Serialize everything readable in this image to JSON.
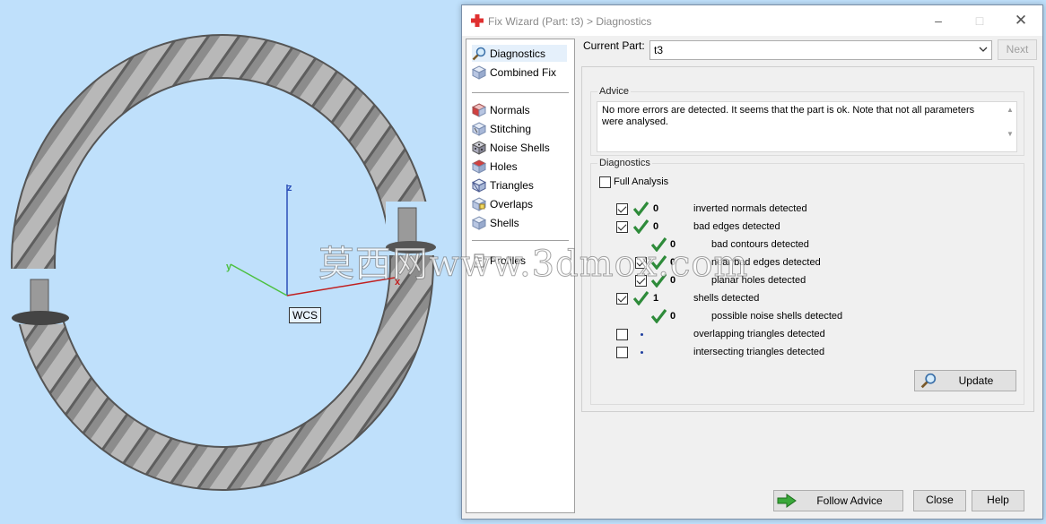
{
  "window": {
    "title": "Fix Wizard (Part: t3) > Diagnostics"
  },
  "viewport": {
    "wcs_label": "WCS",
    "axis_x": "x",
    "axis_y": "y",
    "axis_z": "z"
  },
  "nav": {
    "items": [
      {
        "label": "Diagnostics",
        "icon": "magnifier-icon"
      },
      {
        "label": "Combined Fix",
        "icon": "cube-icon"
      },
      {
        "label": "Normals",
        "icon": "cube-red-icon"
      },
      {
        "label": "Stitching",
        "icon": "cube-stitch-icon"
      },
      {
        "label": "Noise Shells",
        "icon": "dice-icon"
      },
      {
        "label": "Holes",
        "icon": "cube-hole-icon"
      },
      {
        "label": "Triangles",
        "icon": "cube-triangle-icon"
      },
      {
        "label": "Overlaps",
        "icon": "cube-overlap-icon"
      },
      {
        "label": "Shells",
        "icon": "cube-shell-icon"
      },
      {
        "label": "Profiles",
        "icon": "profile-icon"
      }
    ]
  },
  "part": {
    "label": "Current Part:",
    "value": "t3",
    "next_label": "Next"
  },
  "advice": {
    "title": "Advice",
    "text": "No more errors are detected. It seems that the part is ok. Note that not all parameters were analysed."
  },
  "diagnostics": {
    "title": "Diagnostics",
    "full_analysis": "Full Analysis",
    "rows": [
      {
        "count": "0",
        "text": "inverted normals detected"
      },
      {
        "count": "0",
        "text": "bad edges detected"
      },
      {
        "count": "0",
        "text": "bad contours detected"
      },
      {
        "count": "0",
        "text": "near bad edges detected"
      },
      {
        "count": "0",
        "text": "planar holes detected"
      },
      {
        "count": "1",
        "text": "shells detected"
      },
      {
        "count": "0",
        "text": "possible noise shells detected"
      },
      {
        "count": "",
        "text": "overlapping triangles detected"
      },
      {
        "count": "",
        "text": "intersecting triangles detected"
      }
    ],
    "update_label": "Update"
  },
  "footer": {
    "follow_label": "Follow Advice",
    "close_label": "Close",
    "help_label": "Help"
  },
  "watermark": "莫西网www.3dmox.com",
  "colors": {
    "check": "#2e8b3a",
    "arrow": "#3aa83a",
    "title_cross": "#e03030"
  }
}
